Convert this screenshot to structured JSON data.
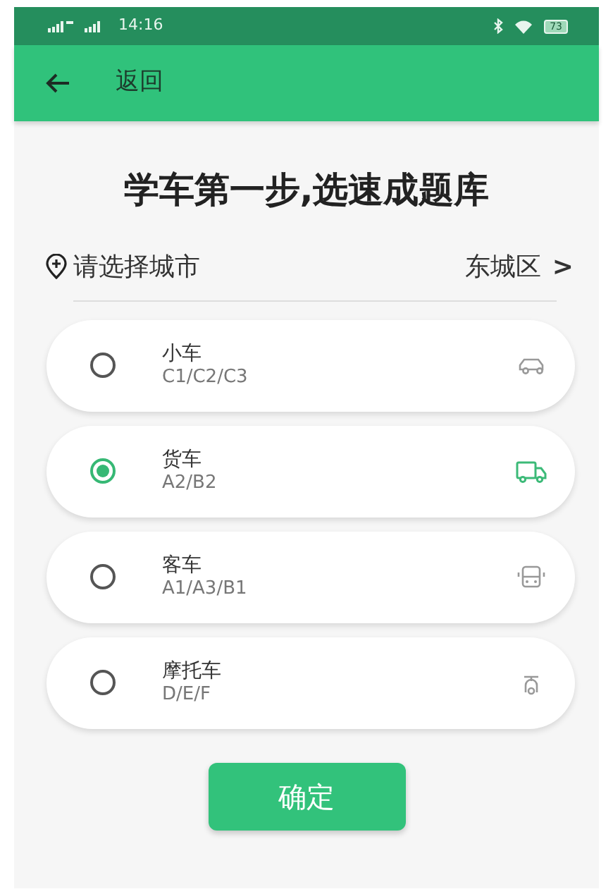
{
  "status_bar": {
    "time": "14:16",
    "battery": "73"
  },
  "app_bar": {
    "back_label": "返回"
  },
  "heading": "学车第一步,选速成题库",
  "city": {
    "label": "请选择城市",
    "value": "东城区",
    "chevron": ">"
  },
  "vehicles": [
    {
      "name": "小车",
      "licenses": "C1/C2/C3",
      "kind": "car",
      "selected": false
    },
    {
      "name": "货车",
      "licenses": "A2/B2",
      "kind": "truck",
      "selected": true
    },
    {
      "name": "客车",
      "licenses": "A1/A3/B1",
      "kind": "bus",
      "selected": false
    },
    {
      "name": "摩托车",
      "licenses": "D/E/F",
      "kind": "scooter",
      "selected": false
    }
  ],
  "confirm_button": "确定"
}
